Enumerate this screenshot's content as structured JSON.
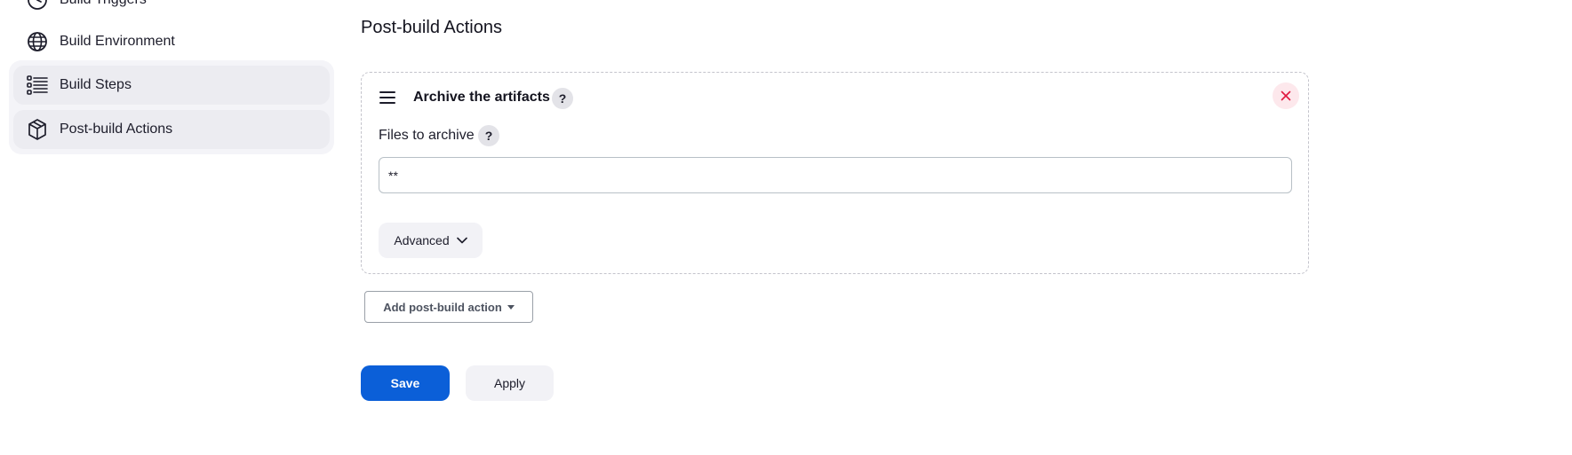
{
  "sidebar": {
    "items": [
      {
        "label": "Build Triggers",
        "icon": "clock-icon"
      },
      {
        "label": "Build Environment",
        "icon": "globe-icon"
      },
      {
        "label": "Build Steps",
        "icon": "list-icon"
      },
      {
        "label": "Post-build Actions",
        "icon": "package-icon"
      }
    ]
  },
  "main": {
    "section_title": "Post-build Actions",
    "card": {
      "title": "Archive the artifacts",
      "help": "?",
      "files_label": "Files to archive",
      "files_help": "?",
      "files_value": "**",
      "advanced_label": "Advanced"
    },
    "add_action_label": "Add post-build action",
    "save_label": "Save",
    "apply_label": "Apply"
  },
  "colors": {
    "primary": "#0b5fd8",
    "danger": "#e0193f",
    "selected_bg": "#ececf1"
  }
}
